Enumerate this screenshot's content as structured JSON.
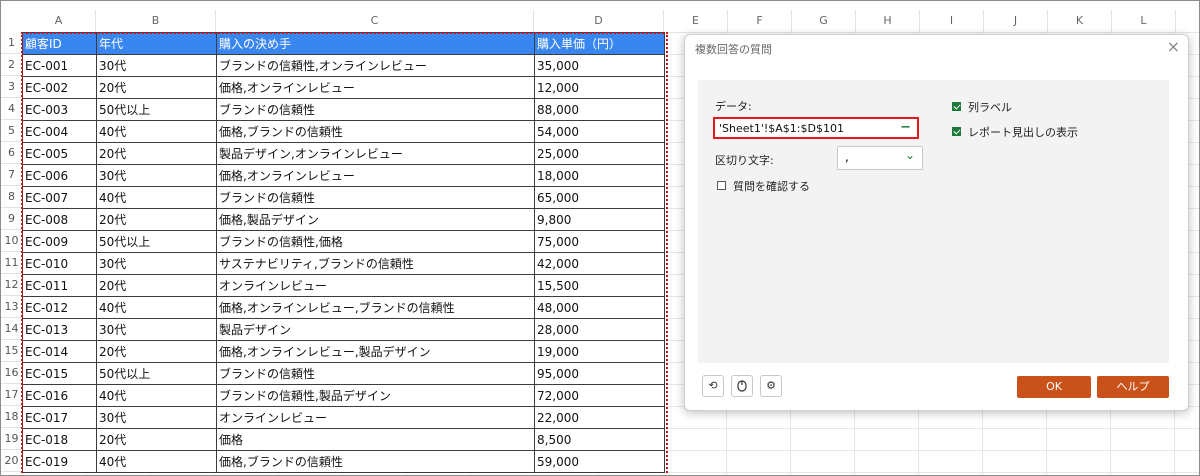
{
  "columns": [
    "A",
    "B",
    "C",
    "D",
    "E",
    "F",
    "G",
    "H",
    "I",
    "J",
    "K",
    "L"
  ],
  "rows": [
    "1",
    "2",
    "3",
    "4",
    "5",
    "6",
    "7",
    "8",
    "9",
    "10",
    "11",
    "12",
    "13",
    "14",
    "15",
    "16",
    "17",
    "18",
    "19",
    "20"
  ],
  "sheet": {
    "header": [
      "顧客ID",
      "年代",
      "購入の決め手",
      "購入単価（円）"
    ],
    "data": [
      [
        "EC-001",
        "30代",
        "ブランドの信頼性,オンラインレビュー",
        "35,000"
      ],
      [
        "EC-002",
        "20代",
        "価格,オンラインレビュー",
        "12,000"
      ],
      [
        "EC-003",
        "50代以上",
        "ブランドの信頼性",
        "88,000"
      ],
      [
        "EC-004",
        "40代",
        "価格,ブランドの信頼性",
        "54,000"
      ],
      [
        "EC-005",
        "20代",
        "製品デザイン,オンラインレビュー",
        "25,000"
      ],
      [
        "EC-006",
        "30代",
        "価格,オンラインレビュー",
        "18,000"
      ],
      [
        "EC-007",
        "40代",
        "ブランドの信頼性",
        "65,000"
      ],
      [
        "EC-008",
        "20代",
        "価格,製品デザイン",
        "9,800"
      ],
      [
        "EC-009",
        "50代以上",
        "ブランドの信頼性,価格",
        "75,000"
      ],
      [
        "EC-010",
        "30代",
        "サステナビリティ,ブランドの信頼性",
        "42,000"
      ],
      [
        "EC-011",
        "20代",
        "オンラインレビュー",
        "15,500"
      ],
      [
        "EC-012",
        "40代",
        "価格,オンラインレビュー,ブランドの信頼性",
        "48,000"
      ],
      [
        "EC-013",
        "30代",
        "製品デザイン",
        "28,000"
      ],
      [
        "EC-014",
        "20代",
        "価格,オンラインレビュー,製品デザイン",
        "19,000"
      ],
      [
        "EC-015",
        "50代以上",
        "ブランドの信頼性",
        "95,000"
      ],
      [
        "EC-016",
        "40代",
        "ブランドの信頼性,製品デザイン",
        "72,000"
      ],
      [
        "EC-017",
        "30代",
        "オンラインレビュー",
        "22,000"
      ],
      [
        "EC-018",
        "20代",
        "価格",
        "8,500"
      ],
      [
        "EC-019",
        "40代",
        "価格,ブランドの信頼性",
        "59,000"
      ]
    ]
  },
  "dialog": {
    "title": "複数回答の質問",
    "close_icon": "×",
    "data_label": "データ:",
    "data_value": "'Sheet1'!$A$1:$D$101",
    "collapse_icon": "−",
    "separator_label": "区切り文字:",
    "separator_value": ",",
    "confirm_label": "質問を確認する",
    "confirm_checked": false,
    "col_label_label": "列ラベル",
    "col_label_checked": true,
    "report_header_label": "レポート見出しの表示",
    "report_header_checked": true,
    "ok_label": "OK",
    "help_label": "ヘルプ",
    "tools": [
      "reset-icon",
      "mouse-icon",
      "gear-icon"
    ]
  },
  "colors": {
    "header_bg": "#3a86f0",
    "accent_green": "#1e7a3c",
    "button_orange": "#c9511a",
    "highlight_red": "#e01818"
  }
}
